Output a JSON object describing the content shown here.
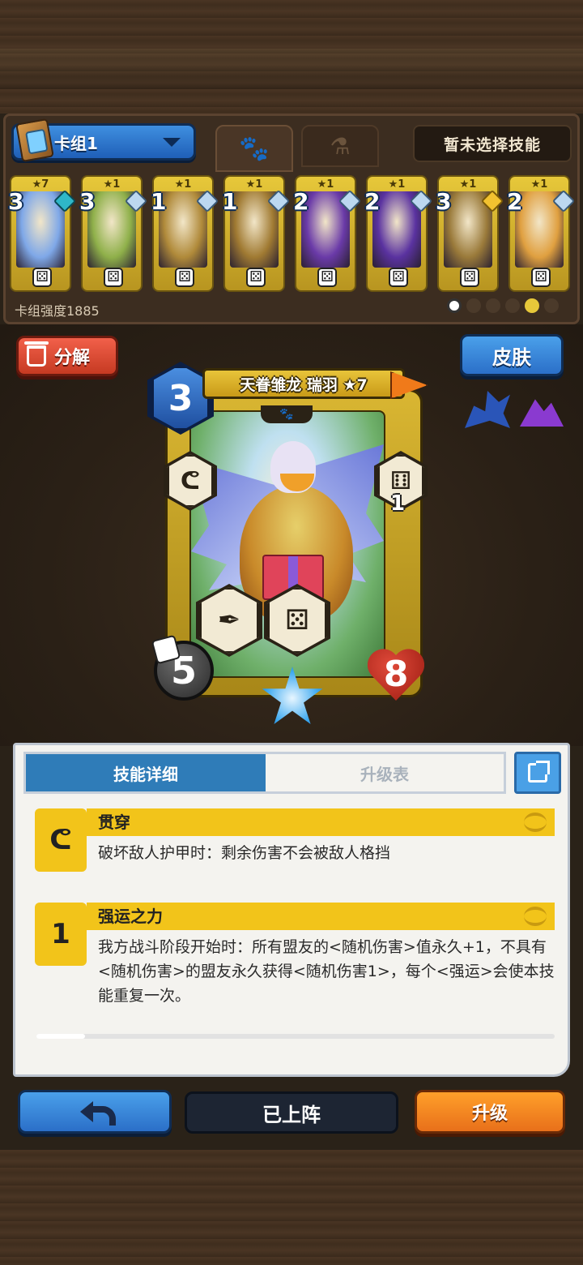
{
  "deck": {
    "name": "卡组1",
    "skill_status": "暂未选择技能",
    "strength_label": "卡组强度1885"
  },
  "tabs": {
    "minions_icon": "paw-icon",
    "spells_icon": "potion-icon"
  },
  "deck_cards": [
    {
      "stars": "★7",
      "level": "3",
      "gem": "teal",
      "art_color": "#7fa8e8"
    },
    {
      "stars": "★1",
      "level": "3",
      "gem": "silver",
      "art_color": "#8fb04a"
    },
    {
      "stars": "★1",
      "level": "1",
      "gem": "silver",
      "art_color": "#b08a3a"
    },
    {
      "stars": "★1",
      "level": "1",
      "gem": "silver",
      "art_color": "#a07a32"
    },
    {
      "stars": "★1",
      "level": "2",
      "gem": "silver",
      "art_color": "#6a3aa8"
    },
    {
      "stars": "★1",
      "level": "2",
      "gem": "silver",
      "art_color": "#5a32a0"
    },
    {
      "stars": "★1",
      "level": "3",
      "gem": "gold",
      "art_color": "#9a7a3a"
    },
    {
      "stars": "★1",
      "level": "2",
      "gem": "silver",
      "art_color": "#e0a040"
    }
  ],
  "actions": {
    "decompose": "分解",
    "skin": "皮肤",
    "back_icon": "back-arrow-icon",
    "deployed": "已上阵",
    "upgrade": "升级"
  },
  "card": {
    "cost": "3",
    "name": "天眷雏龙 瑞羽 ★7",
    "attack": "5",
    "health": "8",
    "luck_bonus": "1",
    "tribe_icons": [
      "dragon-icon",
      "mountain-icon"
    ]
  },
  "detail": {
    "tab_skill": "技能详细",
    "tab_upgrade": "升级表",
    "skills": [
      {
        "name": "贯穿",
        "icon": "hook-icon",
        "desc": "破坏敌人护甲时：剩余伤害不会被敌人格挡"
      },
      {
        "name": "强运之力",
        "icon": "dice-plus-icon",
        "icon_text": "1",
        "desc": "我方战斗阶段开始时：所有盟友的<随机伤害>值永久+1，不具有<随机伤害>的盟友永久获得<随机伤害1>，每个<强运>会使本技能重复一次。"
      }
    ]
  },
  "colors": {
    "accent_blue": "#2f7cb8",
    "skill_yellow": "#f2c41a",
    "upgrade_orange": "#ffa02a",
    "decompose_red": "#f2604a"
  }
}
